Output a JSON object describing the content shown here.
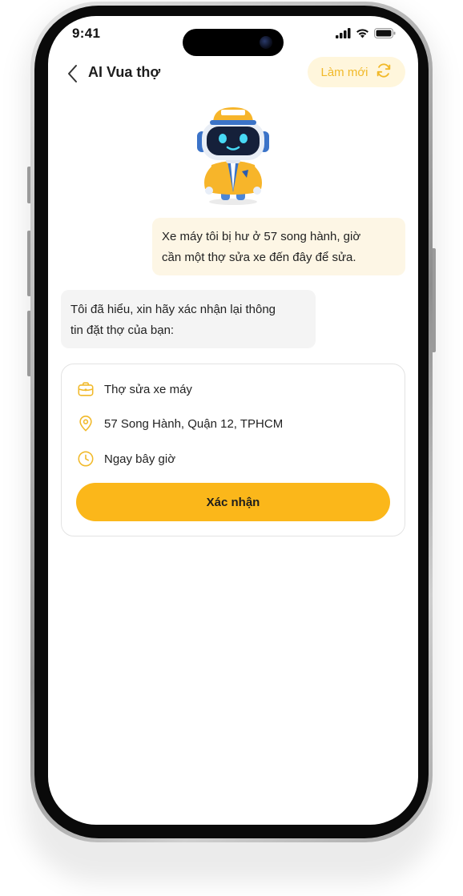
{
  "status_bar": {
    "time": "9:41"
  },
  "header": {
    "title": "AI Vua thợ",
    "refresh_label": "Làm mới"
  },
  "chat": {
    "user_line1": "Xe máy tôi bị hư ở 57 song hành, giờ",
    "user_line2": "cần một thợ sửa xe đến đây để sửa.",
    "bot_line1": "Tôi đã hiểu, xin hãy xác nhận lại thông",
    "bot_line2": "tin đặt thợ của bạn:"
  },
  "booking_card": {
    "service": "Thợ sửa xe máy",
    "address": "57 Song Hành, Quận 12,  TPHCM",
    "time": "Ngay bây giờ",
    "confirm_label": "Xác nhận"
  },
  "colors": {
    "accent": "#FBB71A",
    "accent_light": "#FFF6DC",
    "user_bubble": "#FDF6E5",
    "bot_bubble": "#F4F4F4",
    "icon": "#F1B929"
  },
  "icons": {
    "back": "chevron-left-icon",
    "refresh": "refresh-icon",
    "service": "briefcase-icon",
    "address": "location-pin-icon",
    "time": "clock-icon"
  }
}
